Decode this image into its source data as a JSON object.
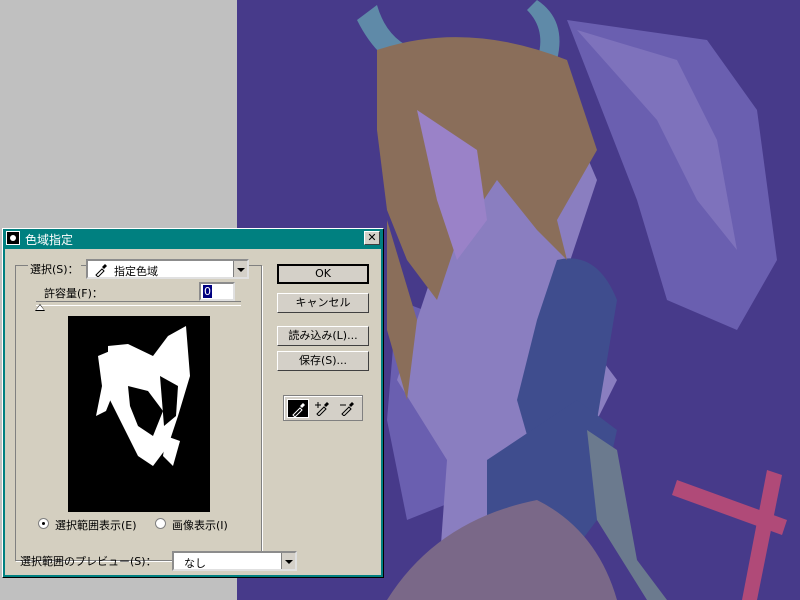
{
  "dialog": {
    "title": "色域指定",
    "select_label": "選択(S)：",
    "select_value": "指定色域",
    "tolerance_label": "許容量(F)：",
    "tolerance_value": "0",
    "radio_selection_label": "選択範囲表示(E)",
    "radio_image_label": "画像表示(I)",
    "selected_radio": "selection",
    "preview_label": "選択範囲のプレビュー(S)：",
    "preview_value": "なし",
    "buttons": {
      "ok": "OK",
      "cancel": "キャンセル",
      "load": "読み込み(L)...",
      "save": "保存(S)..."
    },
    "tools": [
      "eyedropper-icon",
      "eyedropper-plus-icon",
      "eyedropper-minus-icon"
    ]
  },
  "colors": {
    "title_bar": "#008080",
    "dialog_face": "#d4cfc0",
    "canvas_bg": "#4a3a8c",
    "figure_light": "#8a7ec0",
    "hair": "#8a6e5a",
    "wing_dark": "#3c4a8c"
  }
}
